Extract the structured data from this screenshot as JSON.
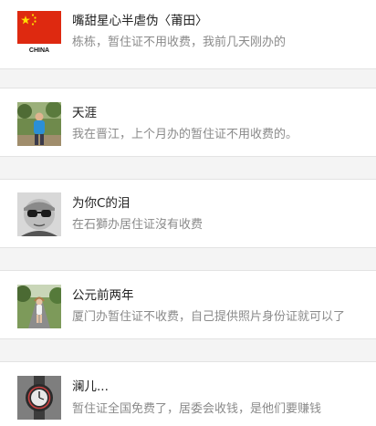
{
  "comments": [
    {
      "avatar": "china-flag-avatar",
      "avatar_caption": "CHINA",
      "name": "嘴甜星心半虐伪〈莆田〉",
      "text": "栋栋，暂住证不用收费，我前几天刚办的"
    },
    {
      "avatar": "person-outdoors-avatar",
      "name": "天涯",
      "text": "我在晋江，上个月办的暂住证不用收费的。"
    },
    {
      "avatar": "child-with-glasses-avatar",
      "name": "为你C的泪",
      "text": "在石獅办居住证沒有收费"
    },
    {
      "avatar": "woman-on-road-avatar",
      "name": "公元前两年",
      "text": "厦门办暂住证不收费，自己提供照片身份证就可以了"
    },
    {
      "avatar": "watch-avatar",
      "name": "澜儿...",
      "text": "暂住证全国免费了，居委会收钱，是他们要赚钱"
    }
  ],
  "colors": {
    "name": "#222222",
    "text": "#8a8a8a",
    "divider": "#e3e3e3",
    "gap_background": "#f4f4f4",
    "flag_red": "#de2910",
    "flag_yellow": "#ffde00"
  }
}
